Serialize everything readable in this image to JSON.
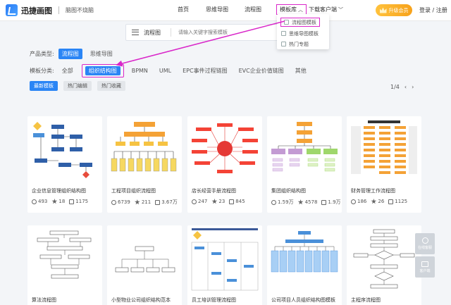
{
  "header": {
    "logo_text": "迅捷画图",
    "slogan": "脑图不烧脑",
    "nav": [
      {
        "label": "首页"
      },
      {
        "label": "思维导图"
      },
      {
        "label": "流程图"
      },
      {
        "label": "模板库"
      },
      {
        "label": "下载客户端"
      }
    ],
    "vip_label": "升级会员",
    "login_label": "登录 / 注册"
  },
  "template_menu": {
    "items": [
      {
        "label": "流程图模板"
      },
      {
        "label": "思维导图模板"
      },
      {
        "label": "热门专题"
      }
    ]
  },
  "search": {
    "type_label": "流程图",
    "placeholder": "请输入关键字搜索模板"
  },
  "filters": {
    "product_label": "产品类型:",
    "products": [
      {
        "label": "流程图"
      },
      {
        "label": "思维导图"
      }
    ],
    "category_label": "模板分类:",
    "categories": [
      {
        "label": "全部"
      },
      {
        "label": "组织结构图"
      },
      {
        "label": "BPMN"
      },
      {
        "label": "UML"
      },
      {
        "label": "EPC事件过程链图"
      },
      {
        "label": "EVC企业价值链图"
      },
      {
        "label": "其他"
      }
    ]
  },
  "sort": {
    "options": [
      {
        "label": "最新模板"
      },
      {
        "label": "热门编辑"
      },
      {
        "label": "热门收藏"
      }
    ]
  },
  "pager": {
    "current": "1/4",
    "prev": "‹",
    "next": "›"
  },
  "cards_row1": [
    {
      "title": "企业信息管理组织结构图",
      "views": "493",
      "stars": "18",
      "copies": "1175"
    },
    {
      "title": "工程项目组织流程图",
      "views": "6739",
      "stars": "211",
      "copies": "3.67万"
    },
    {
      "title": "店长经营手册流程图",
      "views": "247",
      "stars": "23",
      "copies": "845"
    },
    {
      "title": "集团组织结构图",
      "views": "1.59万",
      "stars": "4578",
      "copies": "1.9万"
    },
    {
      "title": "财务管理工作流程图",
      "views": "186",
      "stars": "26",
      "copies": "1125"
    }
  ],
  "cards_row2": [
    {
      "title": "算法流程图"
    },
    {
      "title": "小型物业公司组织结构范本"
    },
    {
      "title": "员工培训管理流程图"
    },
    {
      "title": "公司项目人员组织结构图模板"
    },
    {
      "title": "主程序流程图"
    }
  ],
  "side": {
    "service_label": "在线客服",
    "client_label": "客户端"
  },
  "colors": {
    "accent": "#2a85f5",
    "highlight": "#d926c9",
    "vip": "#f7a21b"
  }
}
